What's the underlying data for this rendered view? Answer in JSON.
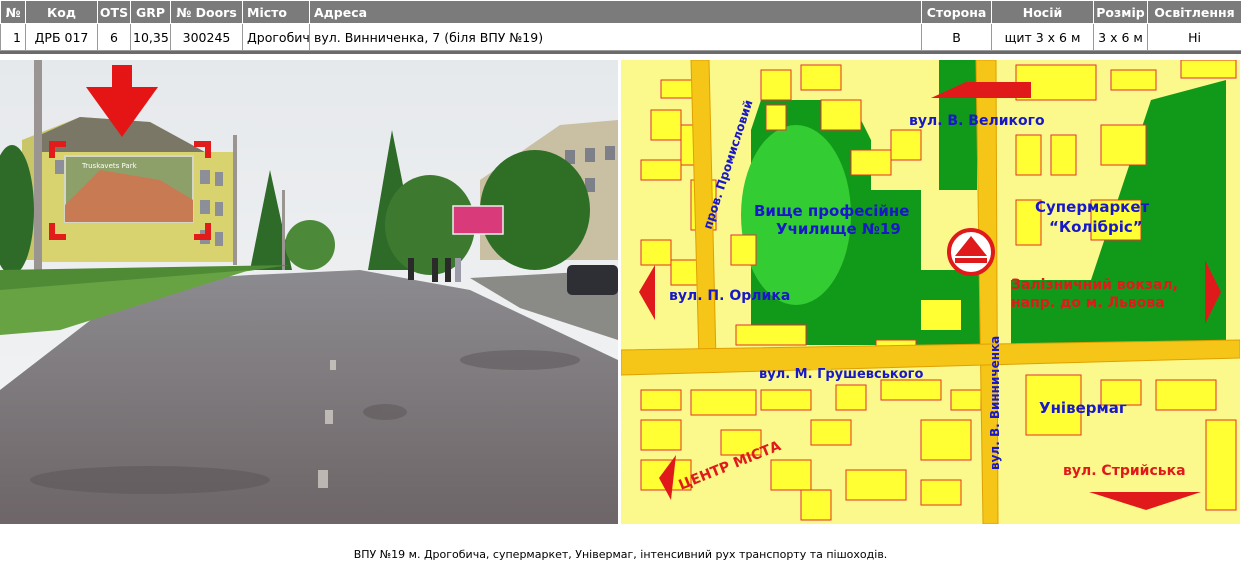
{
  "table": {
    "headers": [
      "№",
      "Код",
      "OTS",
      "GRP",
      "№ Doors",
      "Місто",
      "Адреса",
      "Сторона",
      "Носій",
      "Розмір",
      "Освітлення"
    ],
    "row": [
      "1",
      "ДРБ 017",
      "6",
      "10,35",
      "300245",
      "Дрогобич",
      "вул. Винниченка, 7 (біля ВПУ №19)",
      "В",
      "щит 3 х 6 м",
      "3 х 6 м",
      "Ні"
    ]
  },
  "map": {
    "streets": {
      "v_velykoho": "вул. В. Великого",
      "p_orlyka": "вул. П. Орлика",
      "hrushevskoho": "вул. М. Грушевського",
      "promyslovyi": "пров. Промисловий",
      "vynnychenka": "вул. В. Винниченка",
      "stryiska": "вул. Стрийська",
      "tsentr": "ЦЕНТР МІСТА"
    },
    "landmarks": {
      "school_line1": "Вище професійне",
      "school_line2": "Училище №19",
      "supermarket_line1": "Супермаркет",
      "supermarket_line2": "“Колібріс”",
      "station_line1": "Залізничний вокзал,",
      "station_line2": "напр. до м. Львова",
      "univermah": "Універмаг"
    },
    "colors": {
      "background": "#fbf98c",
      "building": "#ffff33",
      "road": "#f5c518",
      "park_dark": "#11991a",
      "park_light": "#33cc33",
      "label_blue": "#1818c8",
      "label_red": "#e01a1a"
    }
  },
  "photo": {
    "billboard_text": "Truskavets Park"
  },
  "caption": "ВПУ №19 м. Дрогобича, супермаркет, Універмаг, інтенсивний рух транспорту та пішоходів."
}
